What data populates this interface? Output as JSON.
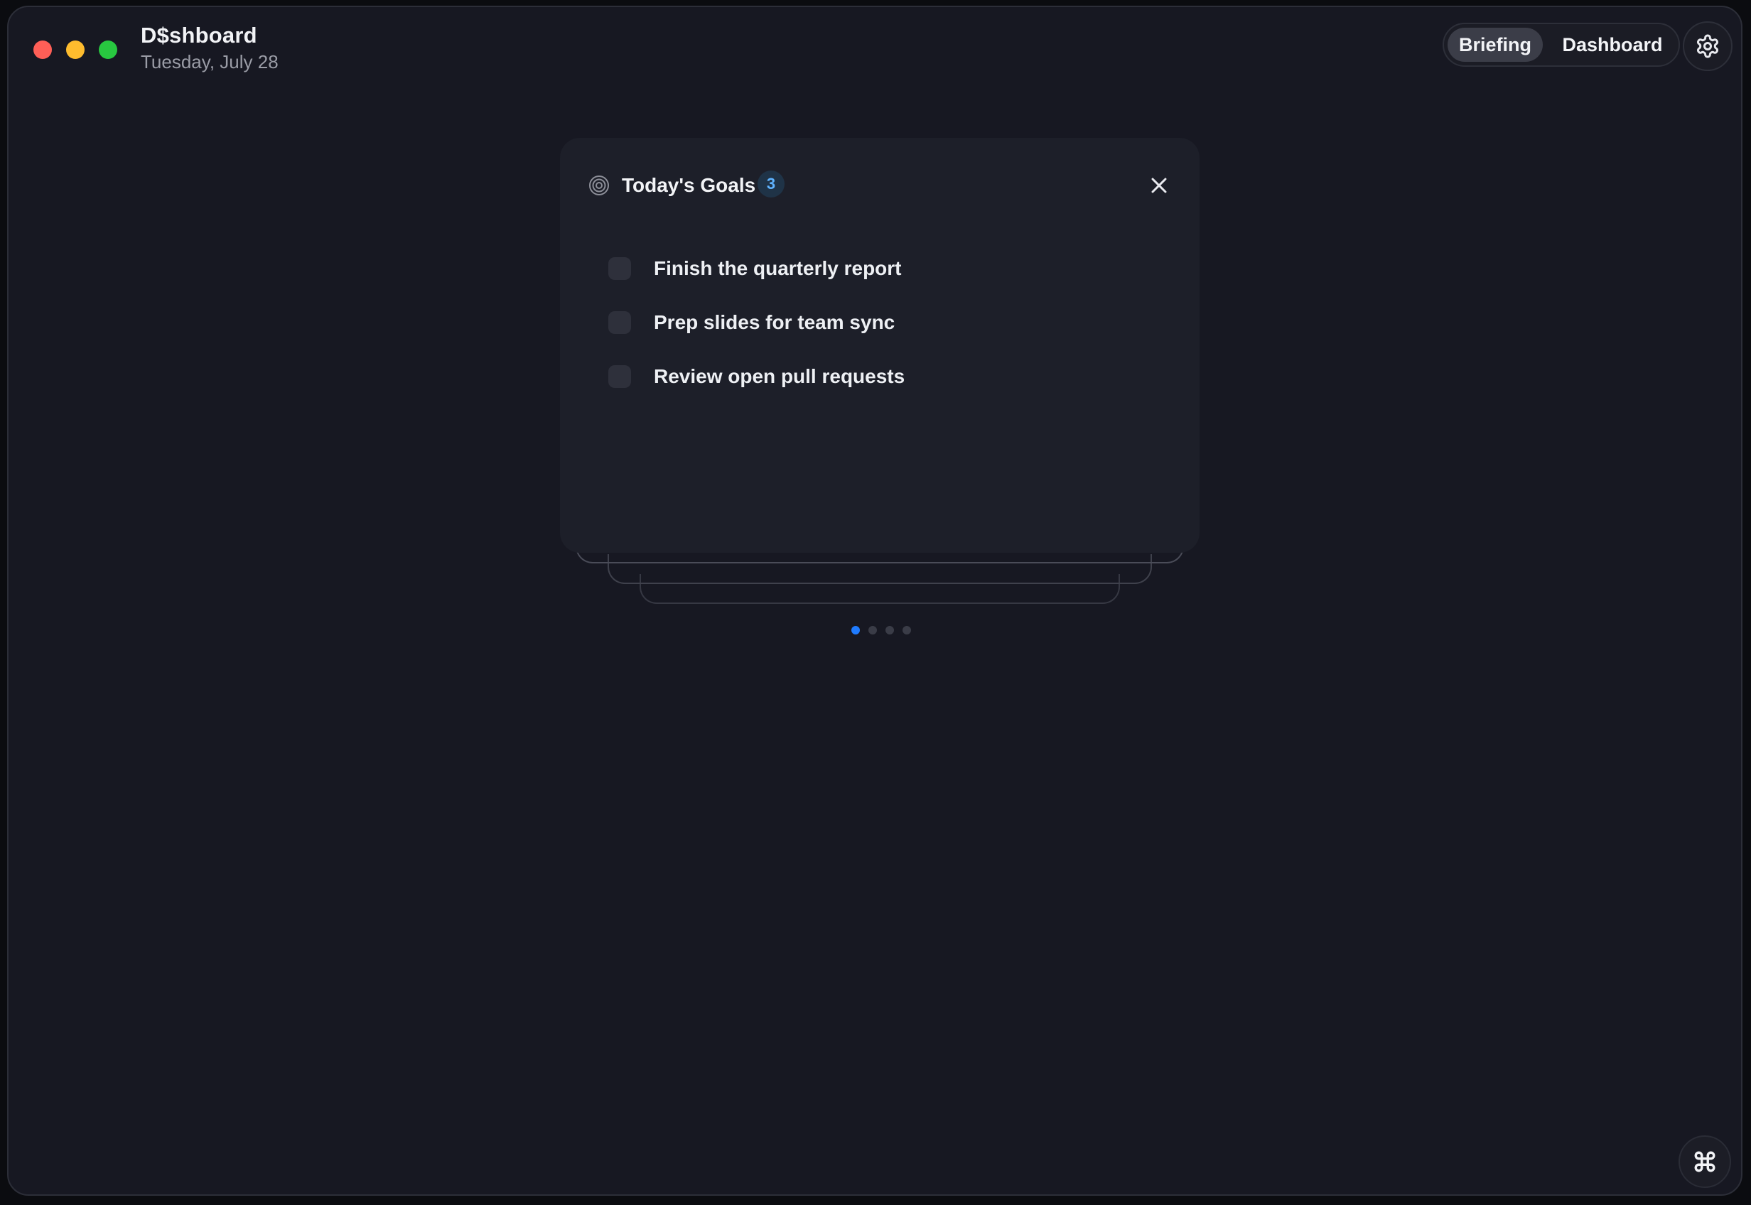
{
  "window": {
    "title": "D$shboard",
    "date": "Tuesday, July 28"
  },
  "view_switcher": {
    "options": [
      {
        "label": "Briefing",
        "active": true
      },
      {
        "label": "Dashboard",
        "active": false
      }
    ]
  },
  "icons": {
    "settings": "gear-icon",
    "goals": "target-icon",
    "close": "close-icon",
    "expand": "command-icon"
  },
  "goals_card": {
    "title": "Today's Goals",
    "count": "3",
    "items": [
      {
        "text": "Finish the quarterly report",
        "done": false
      },
      {
        "text": "Prep slides for team sync",
        "done": false
      },
      {
        "text": "Review open pull requests",
        "done": false
      }
    ]
  },
  "pager": {
    "pages": 4,
    "current": 1
  },
  "colors": {
    "accent": "#1f7bff",
    "badge_text": "#5fb3ff",
    "background": "#171822",
    "card": "#1d1f29"
  }
}
